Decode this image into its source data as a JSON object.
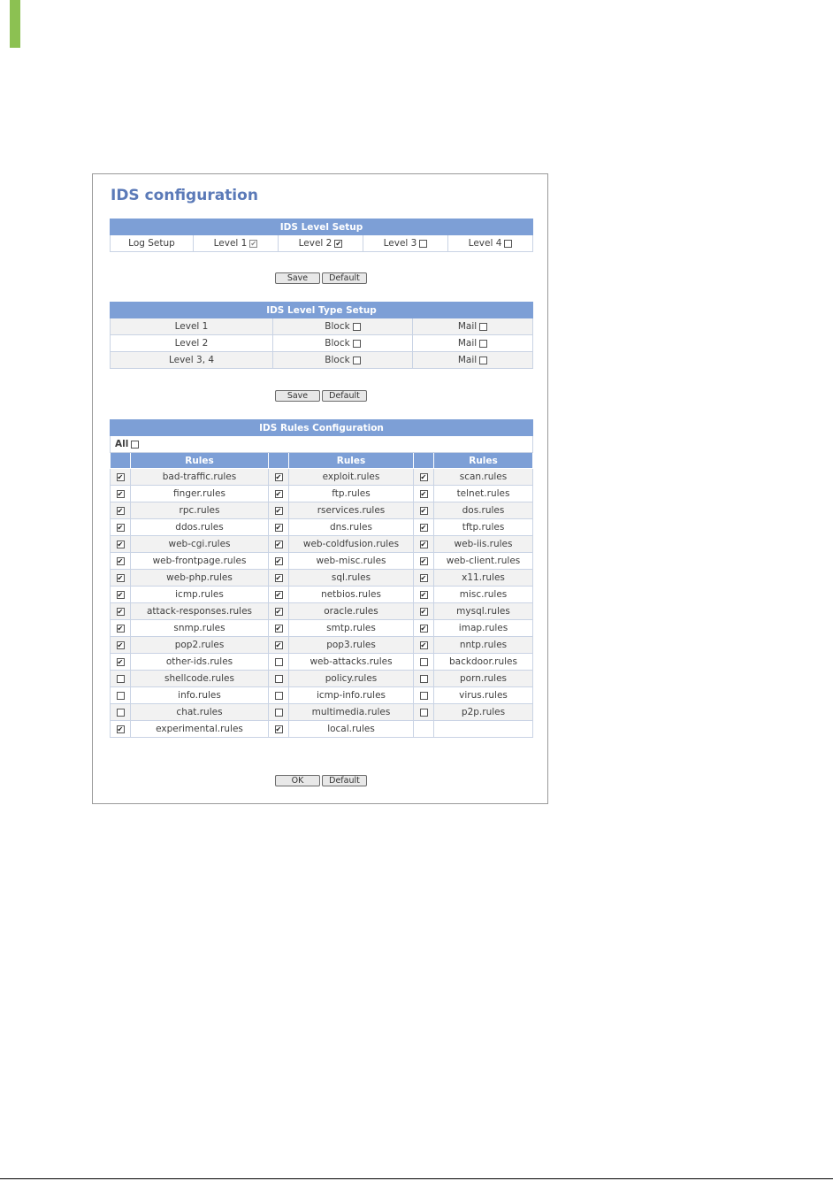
{
  "page": {
    "title": "IDS configuration"
  },
  "level_setup": {
    "header": "IDS Level Setup",
    "log_label": "Log Setup",
    "levels": [
      {
        "label": "Level 1",
        "checked": true,
        "disabled": true
      },
      {
        "label": "Level 2",
        "checked": true,
        "disabled": false
      },
      {
        "label": "Level 3",
        "checked": false,
        "disabled": false
      },
      {
        "label": "Level 4",
        "checked": false,
        "disabled": false
      }
    ],
    "save_label": "Save",
    "default_label": "Default"
  },
  "type_setup": {
    "header": "IDS Level Type Setup",
    "rows": [
      {
        "level": "Level 1",
        "block_label": "Block",
        "block": false,
        "mail_label": "Mail",
        "mail": false
      },
      {
        "level": "Level 2",
        "block_label": "Block",
        "block": false,
        "mail_label": "Mail",
        "mail": false
      },
      {
        "level": "Level 3, 4",
        "block_label": "Block",
        "block": false,
        "mail_label": "Mail",
        "mail": false
      }
    ],
    "save_label": "Save",
    "default_label": "Default"
  },
  "rules": {
    "header": "IDS Rules Configuration",
    "all_label": "All",
    "column_header": "Rules",
    "rows": [
      [
        [
          "bad-traffic.rules",
          true
        ],
        [
          "exploit.rules",
          true
        ],
        [
          "scan.rules",
          true
        ]
      ],
      [
        [
          "finger.rules",
          true
        ],
        [
          "ftp.rules",
          true
        ],
        [
          "telnet.rules",
          true
        ]
      ],
      [
        [
          "rpc.rules",
          true
        ],
        [
          "rservices.rules",
          true
        ],
        [
          "dos.rules",
          true
        ]
      ],
      [
        [
          "ddos.rules",
          true
        ],
        [
          "dns.rules",
          true
        ],
        [
          "tftp.rules",
          true
        ]
      ],
      [
        [
          "web-cgi.rules",
          true
        ],
        [
          "web-coldfusion.rules",
          true
        ],
        [
          "web-iis.rules",
          true
        ]
      ],
      [
        [
          "web-frontpage.rules",
          true
        ],
        [
          "web-misc.rules",
          true
        ],
        [
          "web-client.rules",
          true
        ]
      ],
      [
        [
          "web-php.rules",
          true
        ],
        [
          "sql.rules",
          true
        ],
        [
          "x11.rules",
          true
        ]
      ],
      [
        [
          "icmp.rules",
          true
        ],
        [
          "netbios.rules",
          true
        ],
        [
          "misc.rules",
          true
        ]
      ],
      [
        [
          "attack-responses.rules",
          true
        ],
        [
          "oracle.rules",
          true
        ],
        [
          "mysql.rules",
          true
        ]
      ],
      [
        [
          "snmp.rules",
          true
        ],
        [
          "smtp.rules",
          true
        ],
        [
          "imap.rules",
          true
        ]
      ],
      [
        [
          "pop2.rules",
          true
        ],
        [
          "pop3.rules",
          true
        ],
        [
          "nntp.rules",
          true
        ]
      ],
      [
        [
          "other-ids.rules",
          true
        ],
        [
          "web-attacks.rules",
          false
        ],
        [
          "backdoor.rules",
          false
        ]
      ],
      [
        [
          "shellcode.rules",
          false
        ],
        [
          "policy.rules",
          false
        ],
        [
          "porn.rules",
          false
        ]
      ],
      [
        [
          "info.rules",
          false
        ],
        [
          "icmp-info.rules",
          false
        ],
        [
          "virus.rules",
          false
        ]
      ],
      [
        [
          "chat.rules",
          false
        ],
        [
          "multimedia.rules",
          false
        ],
        [
          "p2p.rules",
          false
        ]
      ],
      [
        [
          "experimental.rules",
          true
        ],
        [
          "local.rules",
          true
        ],
        null
      ]
    ],
    "ok_label": "OK",
    "default_label": "Default"
  },
  "colors": {
    "accent": "#7d9fd6",
    "title": "#5b7ab8",
    "green_bar": "#8cc152"
  }
}
